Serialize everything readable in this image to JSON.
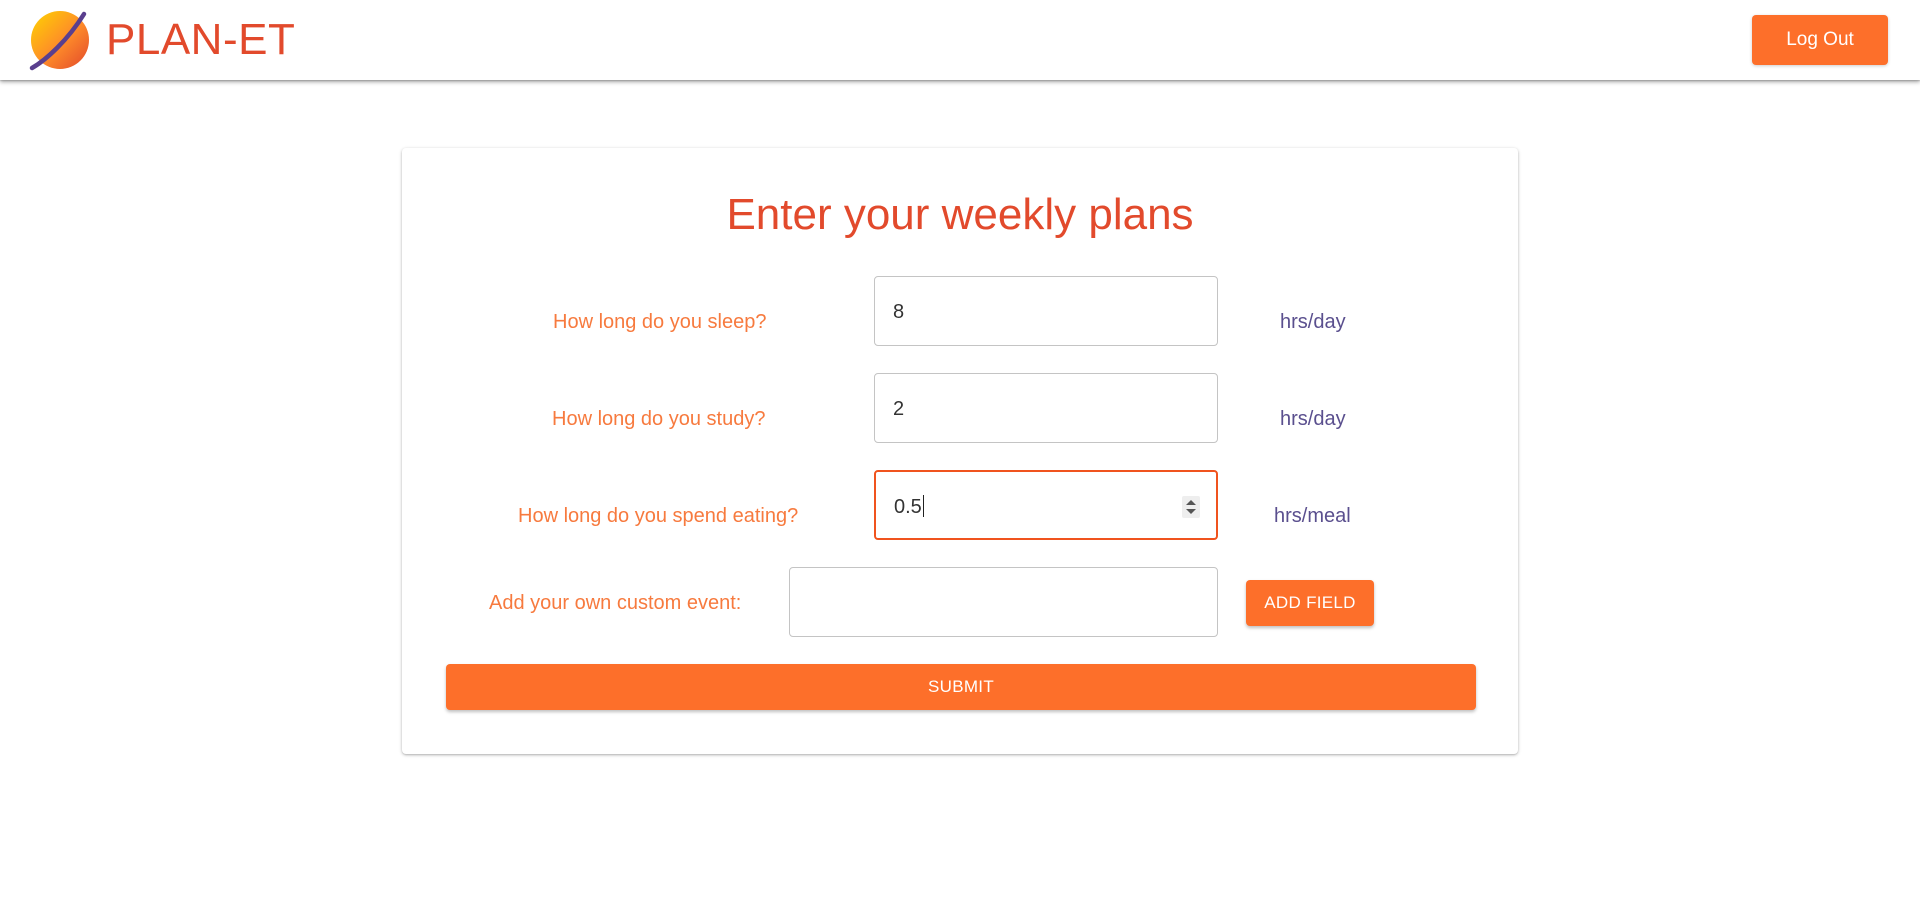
{
  "header": {
    "brand": "PLAN-ET",
    "logo_icon": "planet-logo-icon",
    "logout_label": "Log Out"
  },
  "form": {
    "title": "Enter your weekly plans",
    "rows": [
      {
        "label": "How long do you sleep?",
        "value": "8",
        "unit": "hrs/day"
      },
      {
        "label": "How long do you study?",
        "value": "2",
        "unit": "hrs/day"
      },
      {
        "label": "How long do you spend eating?",
        "value": "0.5",
        "unit": "hrs/meal"
      }
    ],
    "custom": {
      "label": "Add your own custom event:",
      "value": "",
      "add_label": "ADD FIELD"
    },
    "submit_label": "SUBMIT"
  },
  "colors": {
    "accent": "#fd6f2a",
    "title": "#e24a2c",
    "label": "#f77a3e",
    "unit": "#5a4f8e"
  }
}
